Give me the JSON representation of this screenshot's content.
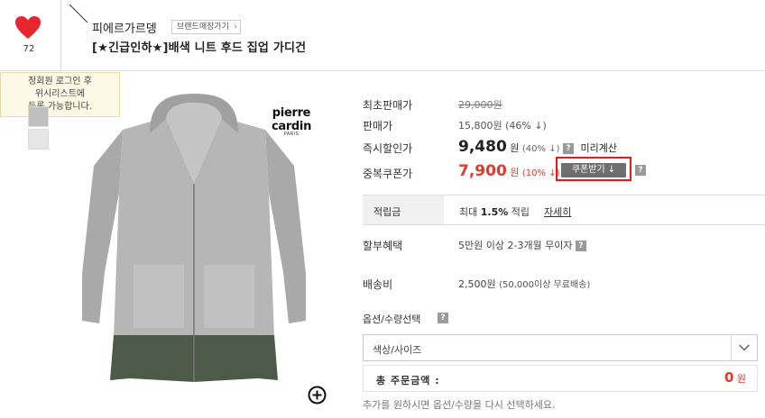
{
  "header": {
    "wish_count": "72",
    "brand_name": "피에르가르뎅",
    "brand_store_label": "브랜드매장가기",
    "product_title": "[★긴급인하★]배색 니트 후드 집업 가디건"
  },
  "tooltip": {
    "line1": "정회원 로그인 후",
    "line2": "위시리스트에",
    "line3": "등록 가능합니다."
  },
  "product_image": {
    "brand_logo": "pierre cardin",
    "brand_logo_sub": "PARIS"
  },
  "prices": {
    "original_label": "최초판매가",
    "original_value": "29,000원",
    "sale_label": "판매가",
    "sale_value": "15,800원 (46% ↓)",
    "instant_label": "즉시할인가",
    "instant_price": "9,480",
    "instant_unit": "원",
    "instant_pct": "(40% ↓)",
    "instant_calc": "미리계산",
    "coupon_label": "중복쿠폰가",
    "coupon_price": "7,900",
    "coupon_unit": "원",
    "coupon_pct": "(10% ↓)",
    "coupon_button": "쿠폰받기 ↓"
  },
  "points": {
    "label": "적립금",
    "prefix": "최대",
    "rate": "1.5%",
    "suffix": "적립",
    "detail_link": "자세히"
  },
  "installment": {
    "label": "할부혜택",
    "value": "5만원 이상 2-3개월 무이자"
  },
  "shipping": {
    "label": "배송비",
    "value": "2,500원",
    "note": "(50,000이상 무료배송)"
  },
  "options": {
    "label": "옵션/수량선택",
    "select_value": "색상/사이즈"
  },
  "total": {
    "label": "총 주문금액 :",
    "amount": "0",
    "unit": "원"
  },
  "help_note": "추가를 원하시면 옵션/수량을 다시 선택하세요.",
  "colors": {
    "accent_red": "#e23a2c",
    "heart_red": "#e8252f",
    "outline_red": "#e41b1b"
  }
}
